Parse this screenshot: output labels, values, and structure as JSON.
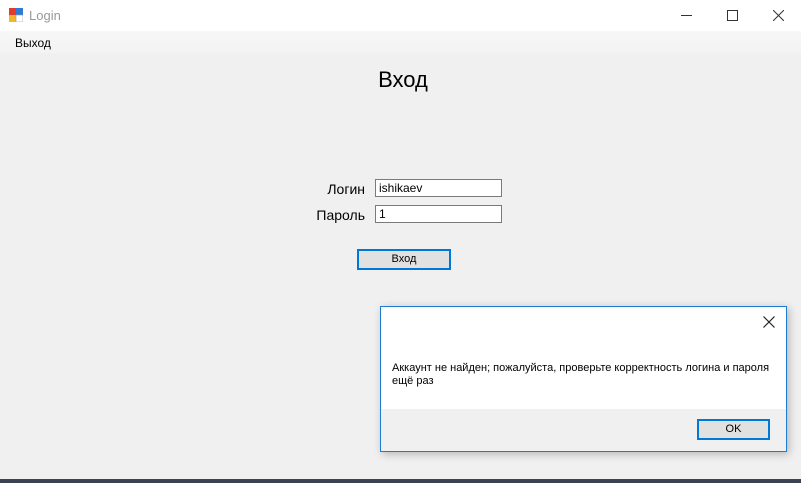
{
  "window": {
    "title": "Login",
    "icon": "app-icon",
    "controls": [
      "minimize-icon",
      "maximize-icon",
      "close-icon"
    ]
  },
  "menu": {
    "items": [
      "Выход"
    ]
  },
  "form": {
    "heading": "Вход",
    "login_label": "Логин",
    "login_value": "ishikaev",
    "password_label": "Пароль",
    "password_value": "1",
    "submit_label": "Вход"
  },
  "dialog": {
    "message": "Аккаунт не найден; пожалуйста, проверьте корректность логина и пароля ещё раз",
    "ok_label": "OK",
    "close_icon": "close-icon"
  },
  "colors": {
    "accent": "#0078d7",
    "background": "#f0f0f0"
  }
}
